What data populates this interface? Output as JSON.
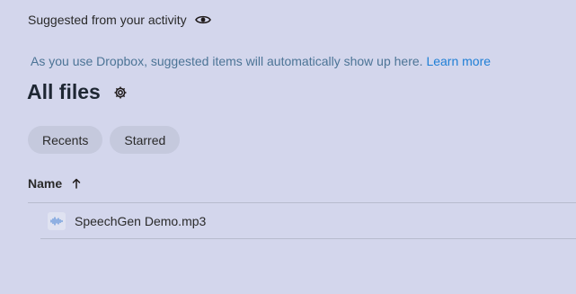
{
  "suggested": {
    "title": "Suggested from your activity",
    "toggle_icon": "eye-icon",
    "hint_text": "As you use Dropbox, suggested items will automatically show up here.",
    "learn_more_label": "Learn more"
  },
  "all_files": {
    "title": "All files",
    "settings_icon": "gear-icon"
  },
  "filters": [
    {
      "label": "Recents"
    },
    {
      "label": "Starred"
    }
  ],
  "table": {
    "columns": [
      {
        "label": "Name",
        "sort": "ascending",
        "sort_icon": "arrow-up-icon"
      }
    ],
    "rows": [
      {
        "name": "SpeechGen Demo.mp3",
        "icon": "audio-file-icon"
      }
    ]
  },
  "colors": {
    "background": "#d3d6ec",
    "link": "#1f7fd6",
    "hint_text": "#4c7496",
    "chip_background": "#c5c9dd"
  }
}
